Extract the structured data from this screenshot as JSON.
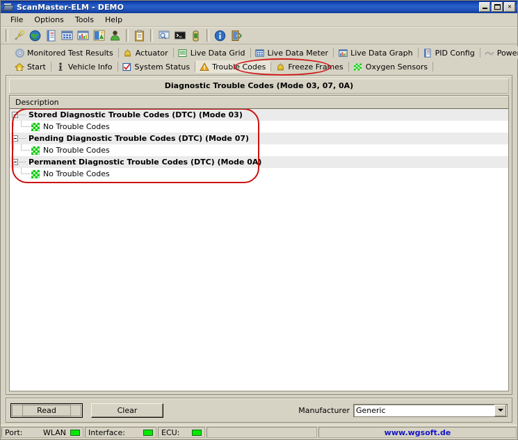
{
  "window": {
    "title": "ScanMaster-ELM - DEMO",
    "icon": "chip-icon",
    "controls": [
      {
        "name": "minimize-button",
        "label": "_"
      },
      {
        "name": "maximize-button",
        "label": "□"
      },
      {
        "name": "close-button",
        "label": "✕"
      }
    ]
  },
  "menu": {
    "items": [
      "File",
      "Options",
      "Tools",
      "Help"
    ]
  },
  "toolbar": {
    "buttons": [
      {
        "name": "connect-icon",
        "title": "Connect"
      },
      {
        "name": "globe-icon",
        "title": "Web"
      },
      {
        "name": "report-icon",
        "title": "Report"
      },
      {
        "name": "grid-icon",
        "title": "Data Grid"
      },
      {
        "name": "bar-chart-icon",
        "title": "Data Graph"
      },
      {
        "name": "image-icon",
        "title": "Picture"
      },
      {
        "name": "user-icon",
        "title": "User"
      },
      {
        "name": "clipboard-icon",
        "title": "Clipboard"
      },
      {
        "name": "terminal-window-icon",
        "title": "Monitor"
      },
      {
        "name": "console-icon",
        "title": "Terminal"
      },
      {
        "name": "battery-icon",
        "title": "Battery"
      },
      {
        "name": "info-icon",
        "title": "Info"
      },
      {
        "name": "exit-icon",
        "title": "Exit"
      }
    ]
  },
  "tabs": {
    "row1": [
      {
        "label": "Monitored Test Results",
        "icon": "gear-icon",
        "selected": false
      },
      {
        "label": "Actuator",
        "icon": "bell-icon",
        "selected": false
      },
      {
        "label": "Live Data Grid",
        "icon": "list-icon",
        "selected": false
      },
      {
        "label": "Live Data Meter",
        "icon": "meter-grid-icon",
        "selected": false
      },
      {
        "label": "Live Data Graph",
        "icon": "bar-chart-icon",
        "selected": false
      },
      {
        "label": "PID Config",
        "icon": "document-icon",
        "selected": false
      },
      {
        "label": "Power",
        "icon": "wave-icon",
        "selected": false
      }
    ],
    "row2": [
      {
        "label": "Start",
        "icon": "home-icon",
        "selected": false
      },
      {
        "label": "Vehicle Info",
        "icon": "info-pin-icon",
        "selected": false
      },
      {
        "label": "System Status",
        "icon": "checkbox-icon",
        "selected": false
      },
      {
        "label": "Trouble Codes",
        "icon": "warning-triangle-icon",
        "selected": true
      },
      {
        "label": "Freeze Frames",
        "icon": "bell-icon",
        "selected": false
      },
      {
        "label": "Oxygen Sensors",
        "icon": "green-grid-icon",
        "selected": false
      }
    ]
  },
  "panel": {
    "title": "Diagnostic Trouble Codes (Mode 03, 07, 0A)",
    "column_header": "Description",
    "tree": [
      {
        "label": "Stored Diagnostic Trouble Codes (DTC) (Mode 03)",
        "expanded": true,
        "children": [
          {
            "label": "No Trouble Codes",
            "icon": "green-grid-icon"
          }
        ]
      },
      {
        "label": "Pending Diagnostic Trouble Codes (DTC) (Mode 07)",
        "expanded": true,
        "children": [
          {
            "label": "No Trouble Codes",
            "icon": "green-grid-icon"
          }
        ]
      },
      {
        "label": "Permanent Diagnostic Trouble Codes (DTC) (Mode 0A)",
        "expanded": true,
        "children": [
          {
            "label": "No Trouble Codes",
            "icon": "green-grid-icon"
          }
        ]
      }
    ]
  },
  "annotations": {
    "highlight_color": "#cc1111",
    "tab_highlight": "Trouble Codes",
    "tree_highlight": "Diagnostic Trouble Codes tree"
  },
  "bottom": {
    "read_button": "Read",
    "clear_button": "Clear",
    "manufacturer_label": "Manufacturer",
    "manufacturer_value": "Generic"
  },
  "status": {
    "port_label": "Port:",
    "port_value": "WLAN",
    "interface_label": "Interface:",
    "ecu_label": "ECU:",
    "website": "www.wgsoft.de",
    "led_color": "#00e800"
  }
}
